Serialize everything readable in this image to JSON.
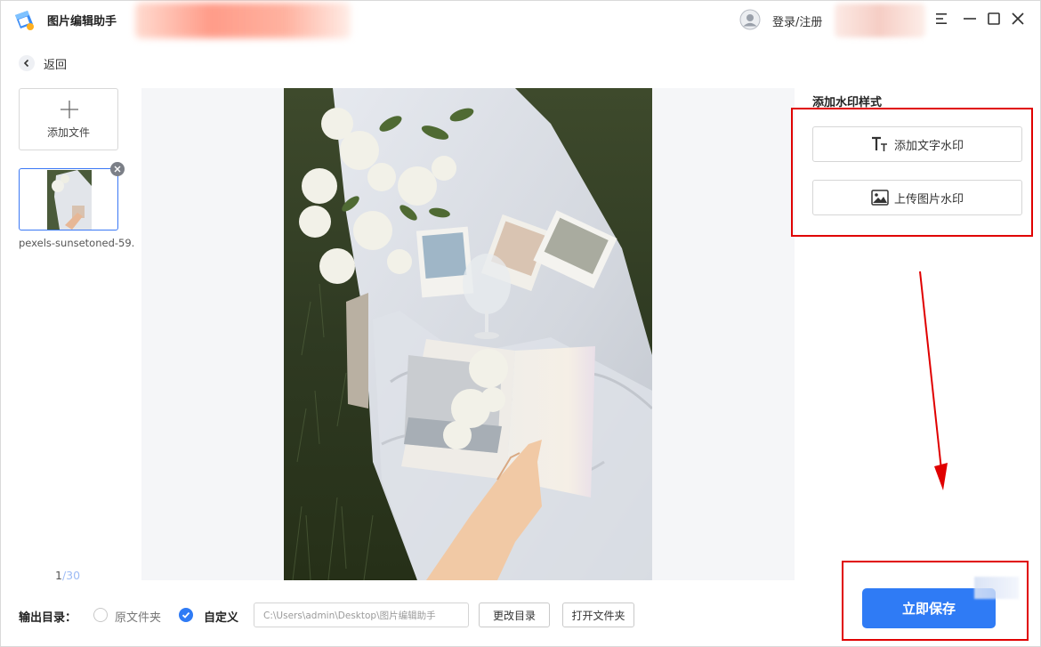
{
  "app": {
    "title": "图片编辑助手",
    "logo_icon": "app-logo-icon"
  },
  "header": {
    "login_label": "登录/注册",
    "window_controls": [
      "menu-icon",
      "minimize-icon",
      "maximize-icon",
      "close-icon"
    ]
  },
  "nav": {
    "back_label": "返回"
  },
  "sidebar": {
    "add_file_label": "添加文件",
    "files": [
      {
        "name": "pexels-sunsetoned-59..."
      }
    ],
    "pager": {
      "current": "1",
      "total": "/30"
    }
  },
  "watermark_panel": {
    "title": "添加水印样式",
    "text_watermark_label": "添加文字水印",
    "image_watermark_label": "上传图片水印"
  },
  "output": {
    "label": "输出目录：",
    "option_original": "原文件夹",
    "option_custom": "自定义",
    "selected": "自定义",
    "path_value": "C:\\Users\\admin\\Desktop\\图片编辑助手",
    "change_dir_label": "更改目录",
    "open_folder_label": "打开文件夹"
  },
  "actions": {
    "save_label": "立即保存"
  },
  "colors": {
    "accent": "#2f7bf5",
    "annotation_red": "#e00000",
    "preview_bg": "#f5f6f8"
  }
}
